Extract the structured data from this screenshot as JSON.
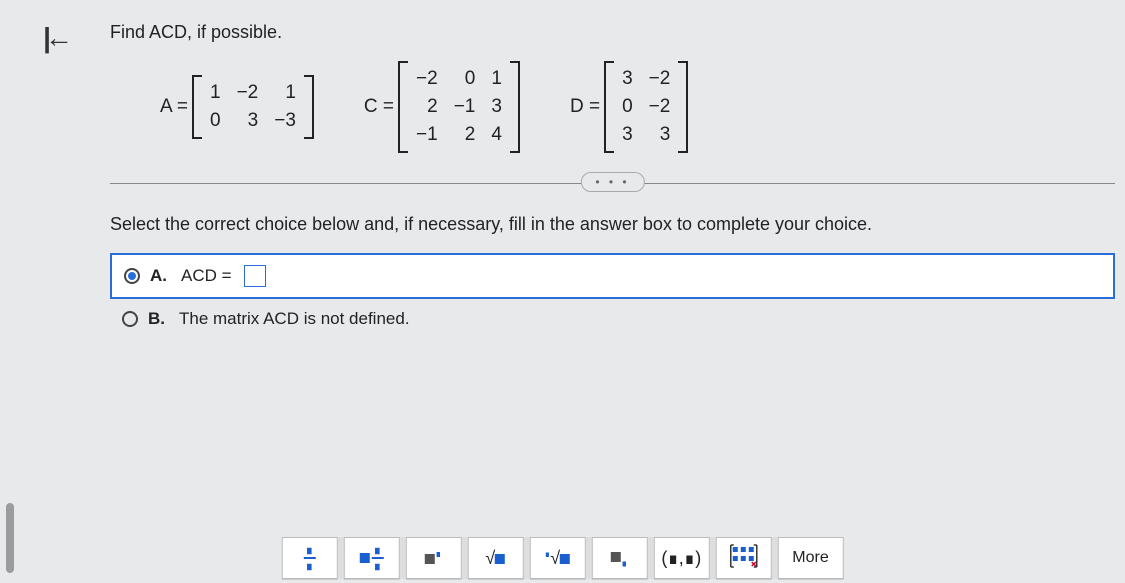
{
  "question": "Find ACD, if possible.",
  "matrices": {
    "A": {
      "label": "A =",
      "rows": [
        [
          "1",
          "−2",
          "1"
        ],
        [
          "0",
          "3",
          "−3"
        ]
      ]
    },
    "C": {
      "label": "C =",
      "rows": [
        [
          "−2",
          "0",
          "1"
        ],
        [
          "2",
          "−1",
          "3"
        ],
        [
          "−1",
          "2",
          "4"
        ]
      ]
    },
    "D": {
      "label": "D =",
      "rows": [
        [
          "3",
          "−2"
        ],
        [
          "0",
          "−2"
        ],
        [
          "3",
          "3"
        ]
      ]
    }
  },
  "dots": "• • •",
  "instruction": "Select the correct choice below and, if necessary, fill in the answer box to complete your choice.",
  "choices": {
    "A": {
      "letter": "A.",
      "text_before": "ACD =",
      "selected": true
    },
    "B": {
      "letter": "B.",
      "text": "The matrix ACD is not defined.",
      "selected": false
    }
  },
  "toolbar": {
    "more": "More",
    "matrix_label": "Matrix",
    "interval": "(∎,∎)"
  }
}
